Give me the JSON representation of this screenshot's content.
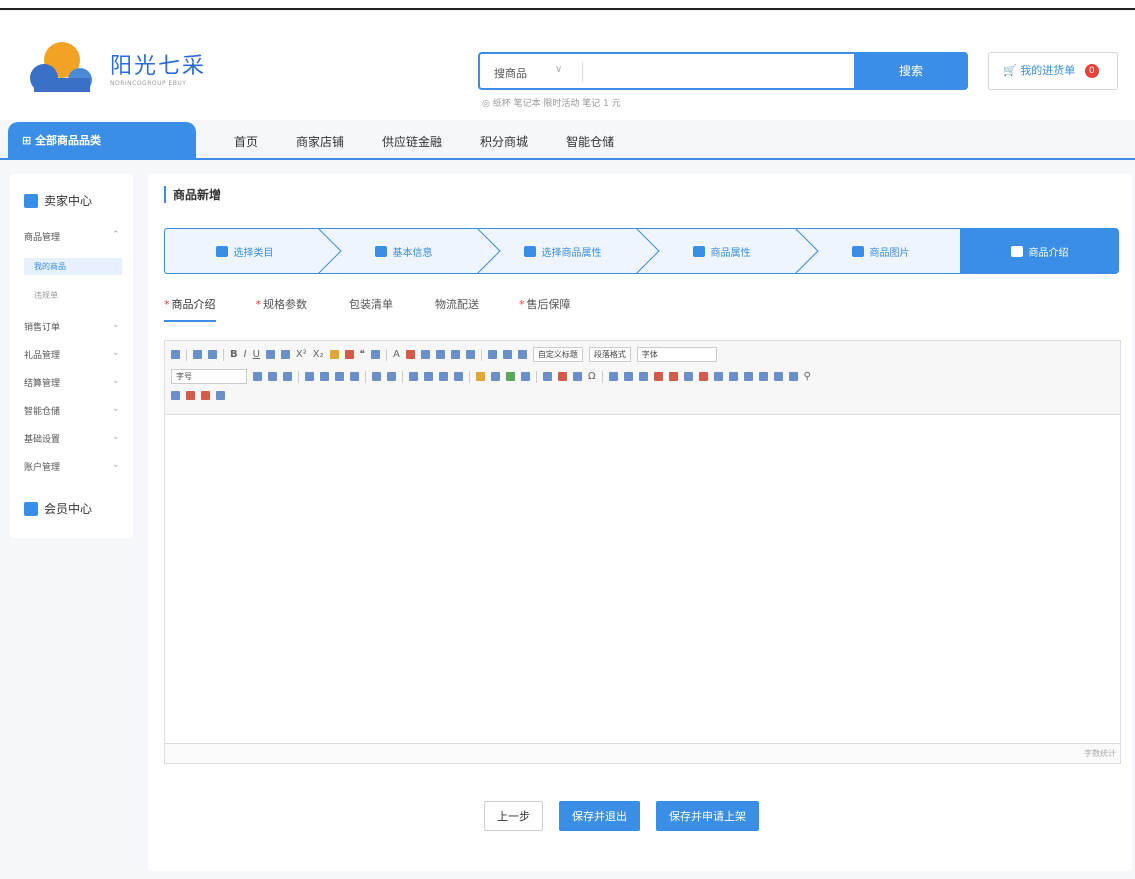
{
  "header": {
    "brand_name": "阳光七采",
    "brand_sub": "NORINCOGROUP EBUY",
    "search_category": "搜商品",
    "search_value": "",
    "search_button": "搜索",
    "hot_words": "◎ 纸杯 笔记本 限时活动 笔记 1 元",
    "cart_label": "我的进货单",
    "cart_count": "0"
  },
  "nav": {
    "all_categories": "全部商品品类",
    "items": [
      "首页",
      "商家店铺",
      "供应链金融",
      "积分商城",
      "智能仓储"
    ]
  },
  "sidebar": {
    "section1": "卖家中心",
    "items": [
      {
        "label": "商品管理",
        "chev": "⌃"
      },
      {
        "label": "销售订单",
        "chev": "⌄"
      },
      {
        "label": "礼品管理",
        "chev": "⌄"
      },
      {
        "label": "结算管理",
        "chev": "⌄"
      },
      {
        "label": "智能仓储",
        "chev": "⌄"
      },
      {
        "label": "基础设置",
        "chev": "⌄"
      },
      {
        "label": "账户管理",
        "chev": "⌄"
      }
    ],
    "sub_items": [
      "我的商品",
      "违规单"
    ],
    "section2": "会员中心"
  },
  "main": {
    "title": "商品新增",
    "steps": [
      "选择类目",
      "基本信息",
      "选择商品属性",
      "商品属性",
      "商品图片",
      "商品介绍"
    ],
    "subtabs": [
      {
        "label": "商品介绍",
        "required": "*"
      },
      {
        "label": "规格参数",
        "required": "*"
      },
      {
        "label": "包装清单",
        "required": ""
      },
      {
        "label": "物流配送",
        "required": ""
      },
      {
        "label": "售后保障",
        "required": "*"
      }
    ],
    "toolbar": {
      "custom_title": "自定义标题",
      "paragraph": "段落格式",
      "font": "字体",
      "size": "字号"
    },
    "counter": "字数统计"
  },
  "actions": {
    "prev": "上一步",
    "save_exit": "保存并退出",
    "save_submit": "保存并申请上架"
  },
  "colors": {
    "accent": "#3a8ee6",
    "badge": "#e8413a"
  }
}
